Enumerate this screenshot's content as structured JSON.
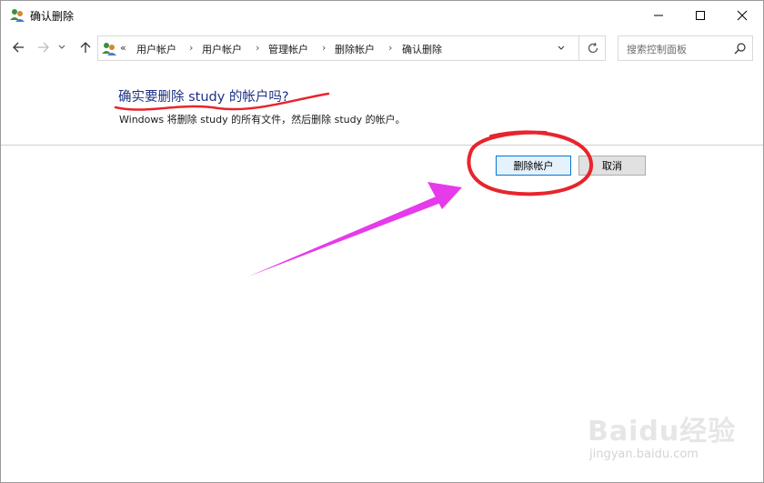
{
  "window": {
    "title": "确认删除",
    "controls": {
      "minimize": "minimize",
      "maximize": "maximize",
      "close": "close"
    }
  },
  "nav": {
    "address_prefix": "«",
    "breadcrumb": [
      "用户帐户",
      "用户帐户",
      "管理帐户",
      "删除帐户",
      "确认删除"
    ],
    "separator": "›",
    "search_placeholder": "搜索控制面板"
  },
  "content": {
    "heading": "确实要删除 study 的帐户吗?",
    "description": "Windows 将删除 study 的所有文件，然后删除 study 的帐户。"
  },
  "buttons": {
    "delete_label": "删除帐户",
    "cancel_label": "取消"
  },
  "annotations": {
    "marker_color": "#e8242c",
    "arrow_color": "#e63bea"
  },
  "watermark": {
    "brand": "Baidu经验",
    "url": "jingyan.baidu.com"
  }
}
